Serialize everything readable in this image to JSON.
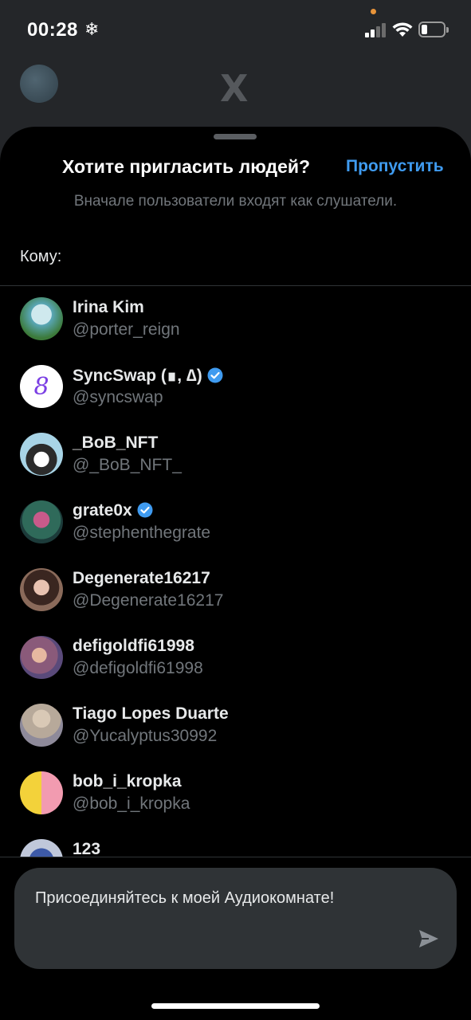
{
  "statusbar": {
    "time": "00:28",
    "weather_icon": "snowflake-icon"
  },
  "background": {
    "logo": "X"
  },
  "sheet": {
    "title": "Хотите пригласить людей?",
    "skip_label": "Пропустить",
    "subtitle": "Вначале пользователи входят как слушатели.",
    "to_label": "Кому:",
    "accent_color": "#3f9bf0",
    "users": [
      {
        "name": "Irina Kim",
        "handle": "@porter_reign",
        "verified": false
      },
      {
        "name": "SyncSwap (∎, ∆)",
        "handle": "@syncswap",
        "verified": true
      },
      {
        "name": "_BoB_NFT",
        "handle": "@_BoB_NFT_",
        "verified": false
      },
      {
        "name": "grate0x",
        "handle": "@stephenthegrate",
        "verified": true
      },
      {
        "name": "Degenerate16217",
        "handle": "@Degenerate16217",
        "verified": false
      },
      {
        "name": "defigoldfi61998",
        "handle": "@defigoldfi61998",
        "verified": false
      },
      {
        "name": "Tiago Lopes Duarte",
        "handle": "@Yucalyptus30992",
        "verified": false
      },
      {
        "name": "bob_i_kropka",
        "handle": "@bob_i_kropka",
        "verified": false
      },
      {
        "name": "123",
        "handle": "",
        "verified": false
      }
    ]
  },
  "composer": {
    "message": "Присоединяйтесь к моей Аудиокомнате!",
    "send_icon": "send-icon"
  }
}
